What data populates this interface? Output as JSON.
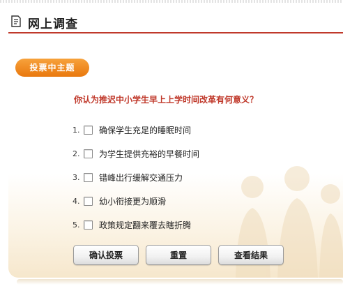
{
  "header": {
    "title": "网上调查",
    "icon": "document-icon"
  },
  "poll": {
    "theme_label": "投票中主题",
    "question": "你认为推迟中小学生早上上学时间改革有何意义？",
    "options": [
      {
        "num": "1.",
        "label": "确保学生充足的睡眠时间",
        "checked": false
      },
      {
        "num": "2.",
        "label": "为学生提供充裕的早餐时间",
        "checked": false
      },
      {
        "num": "3.",
        "label": "错峰出行缓解交通压力",
        "checked": false
      },
      {
        "num": "4.",
        "label": "幼小衔接更为顺滑",
        "checked": false
      },
      {
        "num": "5.",
        "label": "政策规定翻来覆去瞎折腾",
        "checked": false
      }
    ]
  },
  "buttons": {
    "submit": "确认投票",
    "reset": "重置",
    "results": "查看结果"
  },
  "colors": {
    "accent": "#c0392b",
    "pill": "#ef8a1f"
  }
}
